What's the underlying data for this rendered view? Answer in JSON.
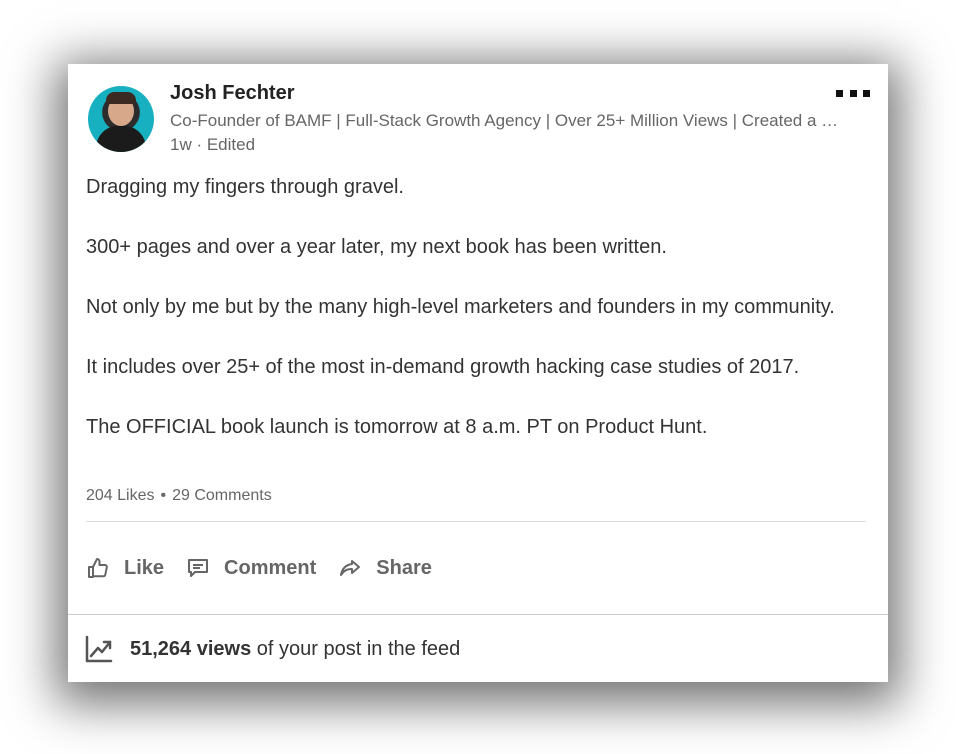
{
  "post": {
    "author_name": "Josh Fechter",
    "author_headline": "Co-Founder of BAMF | Full-Stack Growth Agency | Over 25+ Million Views | Created a …",
    "meta": "1w · Edited",
    "body": [
      "Dragging my fingers through gravel.",
      "300+ pages and over a year later, my next book has been written.",
      "Not only by me but by the many high-level marketers and founders in my community.",
      "It includes over 25+ of the most in-demand growth hacking case studies of 2017.",
      "The OFFICIAL book launch is tomorrow at 8 a.m. PT on Product Hunt."
    ],
    "likes": "204 Likes",
    "comments": "29 Comments"
  },
  "actions": {
    "like": "Like",
    "comment": "Comment",
    "share": "Share"
  },
  "footer": {
    "views_count": "51,264 views",
    "views_text": " of your post in the feed"
  },
  "icons": {
    "more": "more-icon",
    "like": "thumbs-up-icon",
    "comment": "comment-icon",
    "share": "share-arrow-icon",
    "analytics": "trend-chart-icon"
  },
  "colors": {
    "text_primary": "#222222",
    "text_secondary": "#666666",
    "avatar_bg": "#17b0c1"
  }
}
